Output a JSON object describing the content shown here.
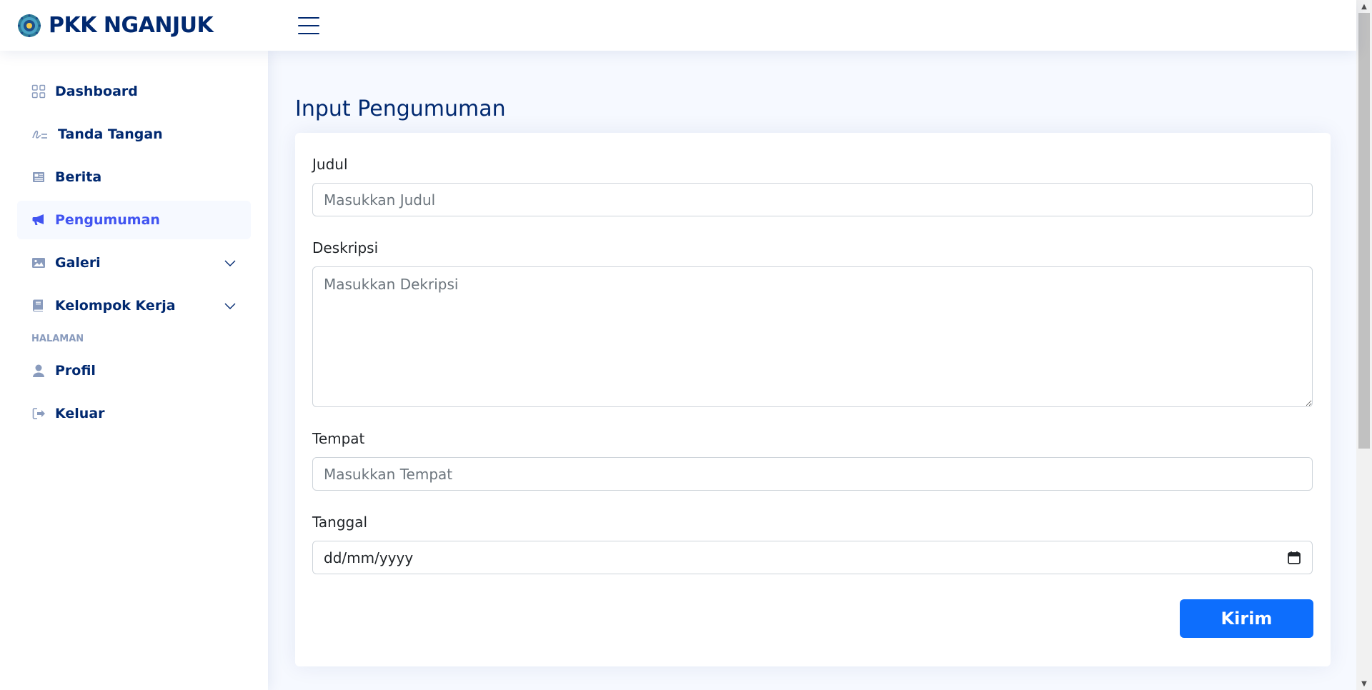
{
  "header": {
    "brand": "PKK NGANJUK",
    "logo_icon": "pkk-emblem-icon",
    "menu_icon": "hamburger-menu-icon"
  },
  "sidebar": {
    "items": [
      {
        "label": "Dashboard",
        "icon": "grid-icon",
        "active": false
      },
      {
        "label": "Tanda Tangan",
        "icon": "signature-icon",
        "active": false
      },
      {
        "label": "Berita",
        "icon": "newspaper-icon",
        "active": false
      },
      {
        "label": "Pengumuman",
        "icon": "megaphone-icon",
        "active": true
      },
      {
        "label": "Galeri",
        "icon": "image-icon",
        "active": false,
        "expandable": true
      },
      {
        "label": "Kelompok Kerja",
        "icon": "book-icon",
        "active": false,
        "expandable": true
      }
    ],
    "section_heading": "HALAMAN",
    "page_items": [
      {
        "label": "Profil",
        "icon": "person-icon"
      },
      {
        "label": "Keluar",
        "icon": "logout-icon"
      }
    ]
  },
  "main": {
    "title": "Input Pengumuman",
    "form": {
      "judul_label": "Judul",
      "judul_placeholder": "Masukkan Judul",
      "deskripsi_label": "Deskripsi",
      "deskripsi_placeholder": "Masukkan Dekripsi",
      "tempat_label": "Tempat",
      "tempat_placeholder": "Masukkan Tempat",
      "tanggal_label": "Tanggal",
      "tanggal_value": "dd/mm/yyyy",
      "submit_label": "Kirim"
    }
  },
  "colors": {
    "primary": "#012970",
    "active": "#4154f1",
    "button": "#0d6efd",
    "background": "#f6f9ff"
  }
}
